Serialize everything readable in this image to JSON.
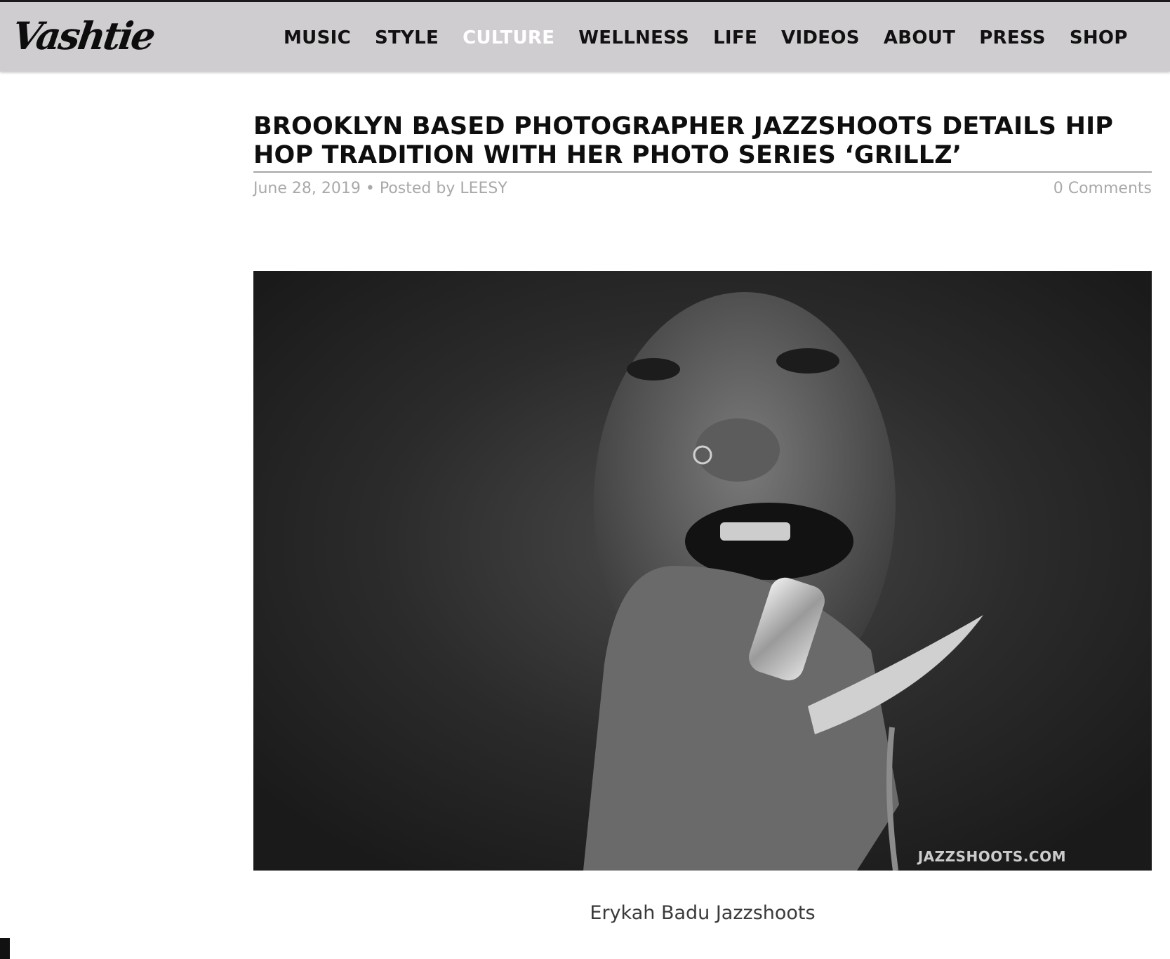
{
  "site": {
    "logo_text": "Vashtie"
  },
  "nav": {
    "items": [
      {
        "label": "MUSIC",
        "active": false
      },
      {
        "label": "STYLE",
        "active": false
      },
      {
        "label": "CULTURE",
        "active": true
      },
      {
        "label": "WELLNESS",
        "active": false
      },
      {
        "label": "LIFE",
        "active": false
      },
      {
        "label": "VIDEOS",
        "active": false
      },
      {
        "label": "ABOUT",
        "active": false
      },
      {
        "label": "PRESS",
        "active": false
      },
      {
        "label": "SHOP",
        "active": false
      }
    ]
  },
  "article": {
    "title": "BROOKLYN BASED PHOTOGRAPHER JAZZSHOOTS DETAILS HIP HOP TRADITION WITH HER PHOTO SERIES ‘GRILLZ’",
    "meta_left": "June 28, 2019 • Posted by LEESY",
    "comments": "0 Comments",
    "photo_watermark": "JAZZSHOOTS.COM",
    "caption": "Erykah Badu Jazzshoots"
  },
  "colors": {
    "topbar_bg": "#cfcdcf",
    "nav_text": "#111111",
    "nav_active": "#ffffff",
    "meta_text": "#a9a9a9"
  }
}
